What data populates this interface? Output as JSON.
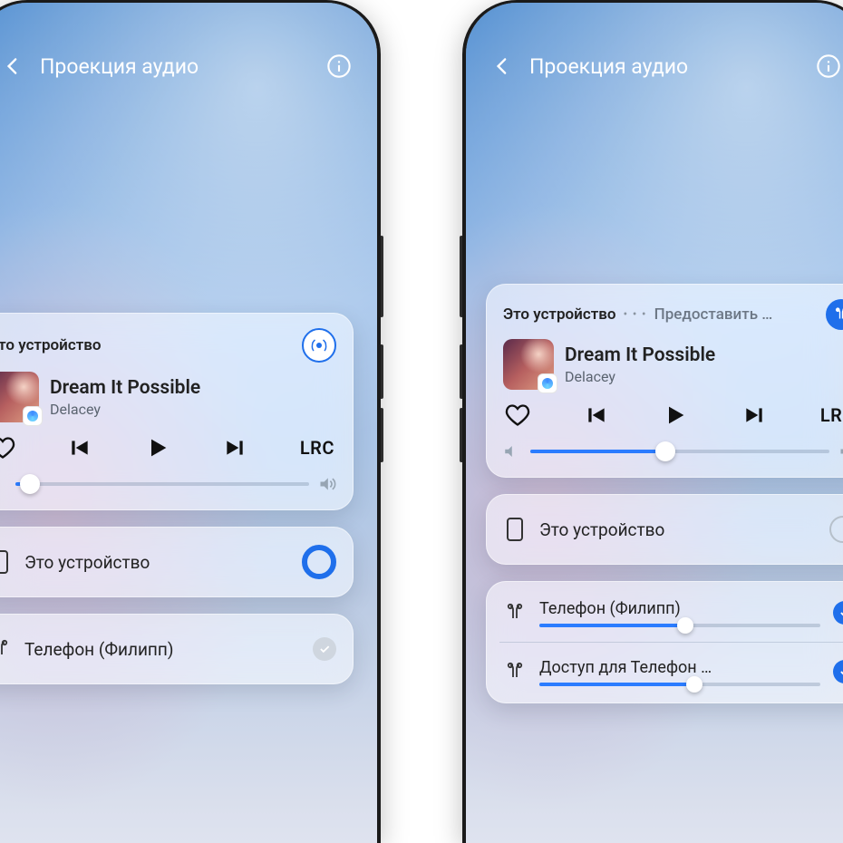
{
  "header": {
    "title": "Проекция аудио"
  },
  "now_playing": {
    "title": "Dream It Possible",
    "artist": "Delacey",
    "lrc": "LRC"
  },
  "left": {
    "tab": "Это устройство",
    "volume_pct": 5,
    "devices": [
      {
        "name": "Это устройство",
        "type": "phone",
        "selected": true
      },
      {
        "name": "Телефон (Филипп)",
        "type": "earbuds",
        "selected": false,
        "grey": true
      }
    ]
  },
  "right": {
    "tab1": "Это устройство",
    "tab2": "Предоставить …",
    "volume_pct": 45,
    "dev_this": "Это устройство",
    "dev_a": {
      "name": "Телефон (Филипп)",
      "vol": 52
    },
    "dev_b": {
      "name": "Доступ для Телефон …",
      "vol": 55
    }
  }
}
